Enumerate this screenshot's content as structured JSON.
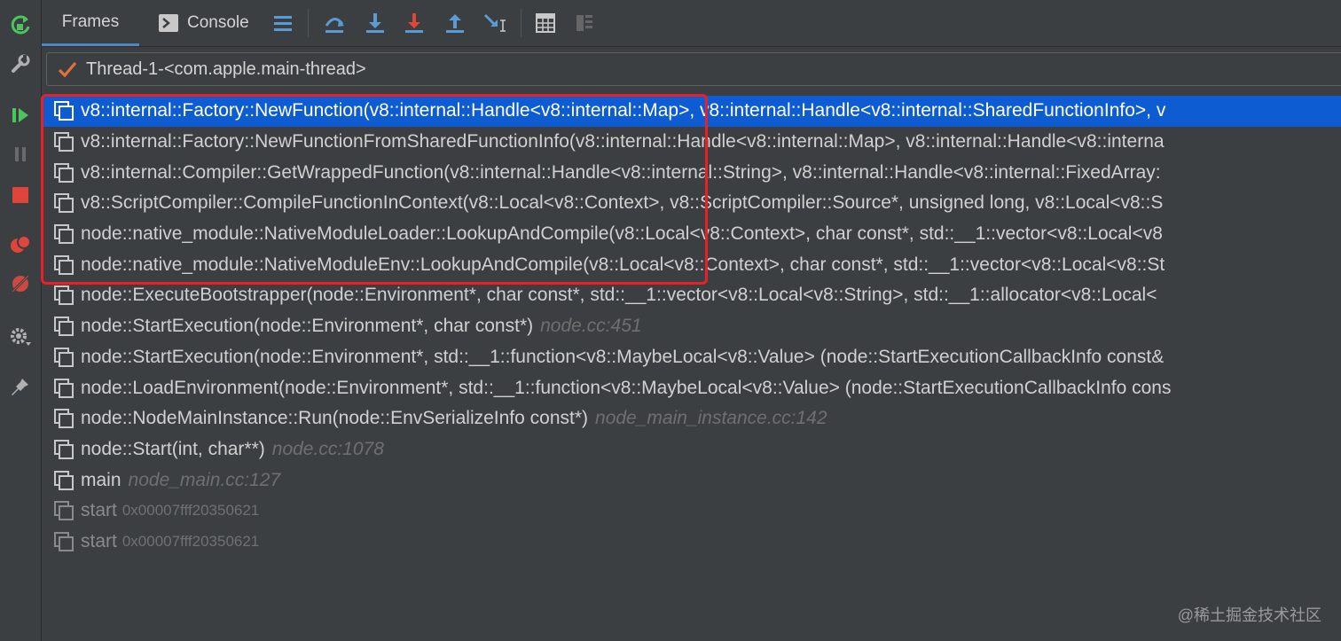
{
  "tabs": [
    {
      "label": "Frames",
      "active": true
    },
    {
      "label": "Console",
      "active": false
    }
  ],
  "thread": {
    "label": "Thread-1-<com.apple.main-thread>"
  },
  "frames": [
    {
      "name": "v8::internal::Factory::NewFunction(v8::internal::Handle<v8::internal::Map>, v8::internal::Handle<v8::internal::SharedFunctionInfo>, v",
      "location": "",
      "address": "",
      "selected": true,
      "dim": false
    },
    {
      "name": "v8::internal::Factory::NewFunctionFromSharedFunctionInfo(v8::internal::Handle<v8::internal::Map>, v8::internal::Handle<v8::interna",
      "location": "",
      "address": "",
      "selected": false,
      "dim": false
    },
    {
      "name": "v8::internal::Compiler::GetWrappedFunction(v8::internal::Handle<v8::internal::String>, v8::internal::Handle<v8::internal::FixedArray:",
      "location": "",
      "address": "",
      "selected": false,
      "dim": false
    },
    {
      "name": "v8::ScriptCompiler::CompileFunctionInContext(v8::Local<v8::Context>, v8::ScriptCompiler::Source*, unsigned long, v8::Local<v8::S",
      "location": "",
      "address": "",
      "selected": false,
      "dim": false
    },
    {
      "name": "node::native_module::NativeModuleLoader::LookupAndCompile(v8::Local<v8::Context>, char const*, std::__1::vector<v8::Local<v8",
      "location": "",
      "address": "",
      "selected": false,
      "dim": false
    },
    {
      "name": "node::native_module::NativeModuleEnv::LookupAndCompile(v8::Local<v8::Context>, char const*, std::__1::vector<v8::Local<v8::St",
      "location": "",
      "address": "",
      "selected": false,
      "dim": false
    },
    {
      "name": "node::ExecuteBootstrapper(node::Environment*, char const*, std::__1::vector<v8::Local<v8::String>, std::__1::allocator<v8::Local<",
      "location": "",
      "address": "",
      "selected": false,
      "dim": false
    },
    {
      "name": "node::StartExecution(node::Environment*, char const*)",
      "location": "node.cc:451",
      "address": "",
      "selected": false,
      "dim": false
    },
    {
      "name": "node::StartExecution(node::Environment*, std::__1::function<v8::MaybeLocal<v8::Value> (node::StartExecutionCallbackInfo const&",
      "location": "",
      "address": "",
      "selected": false,
      "dim": false
    },
    {
      "name": "node::LoadEnvironment(node::Environment*, std::__1::function<v8::MaybeLocal<v8::Value> (node::StartExecutionCallbackInfo cons",
      "location": "",
      "address": "",
      "selected": false,
      "dim": false
    },
    {
      "name": "node::NodeMainInstance::Run(node::EnvSerializeInfo const*)",
      "location": "node_main_instance.cc:142",
      "address": "",
      "selected": false,
      "dim": false
    },
    {
      "name": "node::Start(int, char**)",
      "location": "node.cc:1078",
      "address": "",
      "selected": false,
      "dim": false
    },
    {
      "name": "main",
      "location": "node_main.cc:127",
      "address": "",
      "selected": false,
      "dim": false
    },
    {
      "name": "start",
      "location": "",
      "address": "0x00007fff20350621",
      "selected": false,
      "dim": true
    },
    {
      "name": "start",
      "location": "",
      "address": "0x00007fff20350621",
      "selected": false,
      "dim": true
    }
  ],
  "watermark": "@稀土掘金技术社区",
  "colors": {
    "selection": "#0d5cd1",
    "highlight_box": "#e8202a",
    "resume_green": "#4ec45f",
    "stop_red": "#e0453b"
  }
}
